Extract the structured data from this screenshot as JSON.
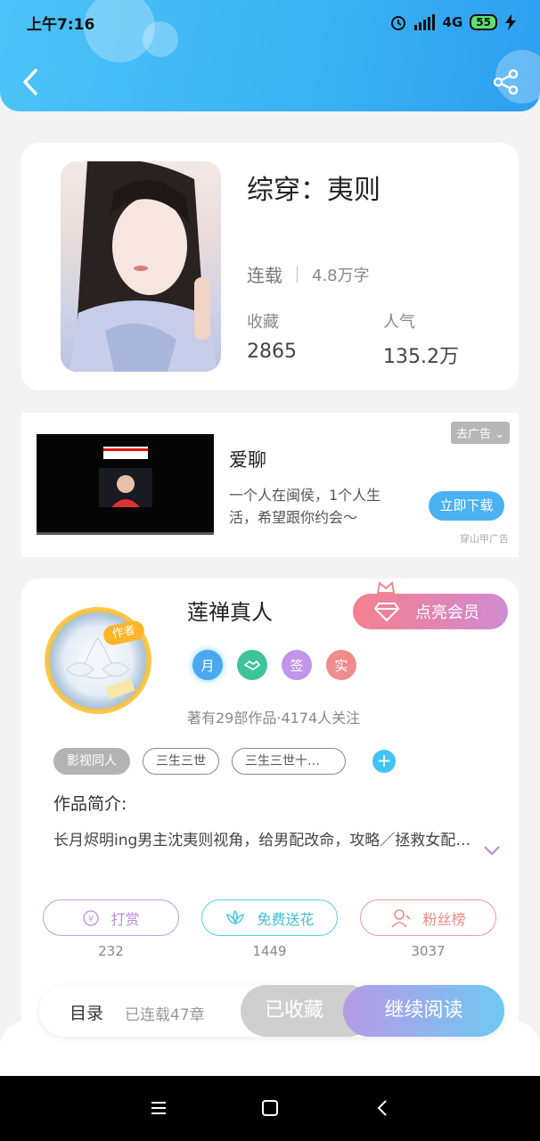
{
  "status_bar": {
    "time": "上午7:16",
    "network": "4G",
    "battery": "55"
  },
  "book": {
    "title": "综穿：夷则",
    "status": "连载",
    "word_count": "4.8万字",
    "favorites_label": "收藏",
    "favorites_value": "2865",
    "popularity_label": "人气",
    "popularity_value": "135.2万"
  },
  "ad": {
    "close_label": "去广告",
    "name": "爱聊",
    "description": "一个人在闽侯，1个人生活，希望跟你约会～",
    "download_label": "立即下载",
    "source": "穿山甲广告"
  },
  "author": {
    "badge": "作者",
    "name": "莲禅真人",
    "vip_label": "点亮会员",
    "badges": [
      "月",
      "",
      "签",
      "实"
    ],
    "info": "著有29部作品·4174人关注",
    "tags": [
      "影视同人",
      "三生三世",
      "三生三世十…"
    ],
    "intro_label": "作品简介:",
    "intro_text": "长月烬明ing男主沈夷则视角，给男配改命，攻略／拯救女配…"
  },
  "actions": [
    {
      "label": "打赏",
      "count": "232",
      "color": "#b98be0"
    },
    {
      "label": "免费送花",
      "count": "1449",
      "color": "#4ccbe0"
    },
    {
      "label": "粉丝榜",
      "count": "3037",
      "color": "#ef8b85"
    }
  ],
  "bottom_bar": {
    "toc_label": "目录",
    "chapters": "已连载47章",
    "collected_label": "已收藏",
    "read_label": "继续阅读"
  },
  "colors": {
    "header": "#3bb3f4",
    "accent": "#41c4f2",
    "vip": "#f5808e"
  }
}
